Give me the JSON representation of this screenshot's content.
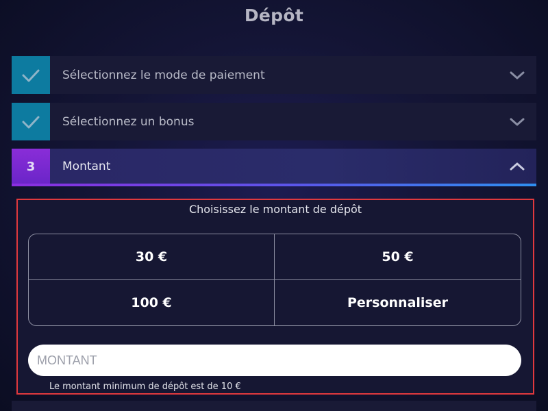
{
  "header": {
    "title": "Dépôt"
  },
  "steps": [
    {
      "label": "Sélectionnez le mode de paiement",
      "badge_icon": "check-icon",
      "state": "completed",
      "chevron": "chevron-down-icon"
    },
    {
      "label": "Sélectionnez un bonus",
      "badge_icon": "check-icon",
      "state": "completed",
      "chevron": "chevron-down-icon"
    },
    {
      "number": "3",
      "label": "Montant",
      "state": "active",
      "chevron": "chevron-up-icon"
    }
  ],
  "amount_panel": {
    "title": "Choisissez le montant de dépôt",
    "options": [
      "30 €",
      "50 €",
      "100 €",
      "Personnaliser"
    ],
    "input": {
      "placeholder": "MONTANT",
      "value": ""
    },
    "hint": "Le montant minimum de dépôt est de 10 €"
  },
  "colors": {
    "completed_badge": "#0d7ba0",
    "active_badge": "#8a2dd8",
    "highlight_border": "#e0393e",
    "background": "#141536"
  }
}
